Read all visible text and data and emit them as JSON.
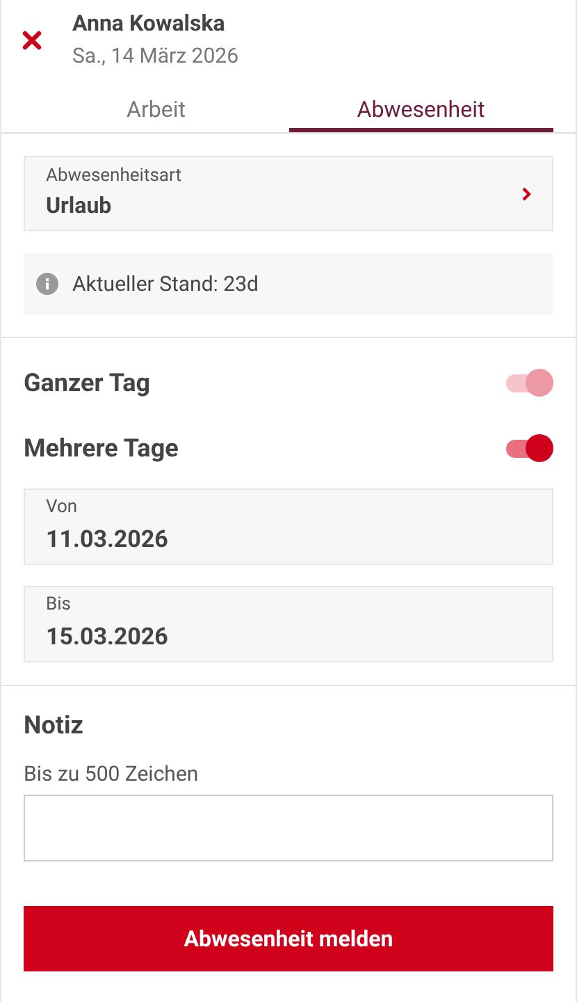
{
  "header": {
    "name": "Anna Kowalska",
    "date": "Sa., 14 März 2026"
  },
  "tabs": [
    {
      "label": "Arbeit",
      "selected": false
    },
    {
      "label": "Abwesenheit",
      "selected": true
    }
  ],
  "absence_type": {
    "label": "Abwesenheitsart",
    "value": "Urlaub"
  },
  "info": "Aktueller Stand: 23d",
  "toggles": [
    {
      "label": "Ganzer Tag",
      "on": true,
      "disabled": true
    },
    {
      "label": "Mehrere Tage",
      "on": true,
      "disabled": false
    }
  ],
  "dates": [
    {
      "label": "Von",
      "value": "11.03.2026"
    },
    {
      "label": "Bis",
      "value": "15.03.2026"
    }
  ],
  "note": {
    "title": "Notiz",
    "hint": "Bis zu 500 Zeichen"
  },
  "submit": "Abwesenheit melden"
}
